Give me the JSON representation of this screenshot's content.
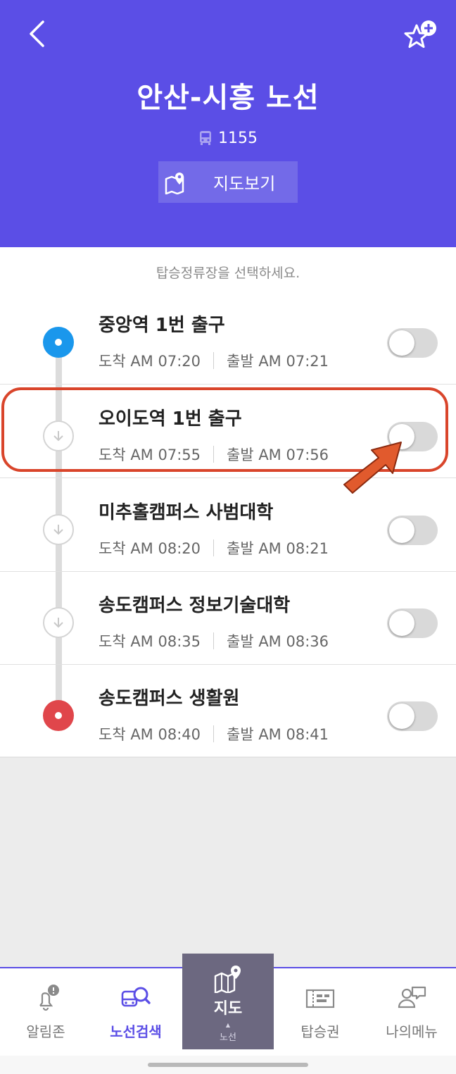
{
  "header": {
    "title": "안산-시흥 노선",
    "bus_number": "1155",
    "map_button_label": "지도보기",
    "background_color": "#5b4ee6"
  },
  "list": {
    "instruction": "탑승정류장을 선택하세요.",
    "stops": [
      {
        "name": "중앙역 1번 출구",
        "arrival": "도착 AM 07:20",
        "departure": "출발 AM 07:21",
        "marker": "start",
        "selected": false
      },
      {
        "name": "오이도역 1번 출구",
        "arrival": "도착 AM 07:55",
        "departure": "출발 AM 07:56",
        "marker": "mid",
        "selected": false
      },
      {
        "name": "미추홀캠퍼스 사범대학",
        "arrival": "도착 AM 08:20",
        "departure": "출발 AM 08:21",
        "marker": "mid",
        "selected": false
      },
      {
        "name": "송도캠퍼스 정보기술대학",
        "arrival": "도착 AM 08:35",
        "departure": "출발 AM 08:36",
        "marker": "mid",
        "selected": false
      },
      {
        "name": "송도캠퍼스 생활원",
        "arrival": "도착 AM 08:40",
        "departure": "출발 AM 08:41",
        "marker": "end",
        "selected": false
      }
    ]
  },
  "tabbar": {
    "tabs": [
      {
        "label": "알림존",
        "icon": "bell-alert-icon",
        "active": false
      },
      {
        "label": "노선검색",
        "icon": "bus-search-icon",
        "active": true
      },
      {
        "label": "지도",
        "sub": "노선",
        "icon": "map-pin-icon",
        "active": false
      },
      {
        "label": "탑승권",
        "icon": "ticket-icon",
        "active": false
      },
      {
        "label": "나의메뉴",
        "icon": "user-menu-icon",
        "active": false
      }
    ]
  },
  "colors": {
    "accent": "#5b4ee6",
    "start_marker": "#1a97ec",
    "end_marker": "#e0464b",
    "annotation": "#d9452b"
  }
}
